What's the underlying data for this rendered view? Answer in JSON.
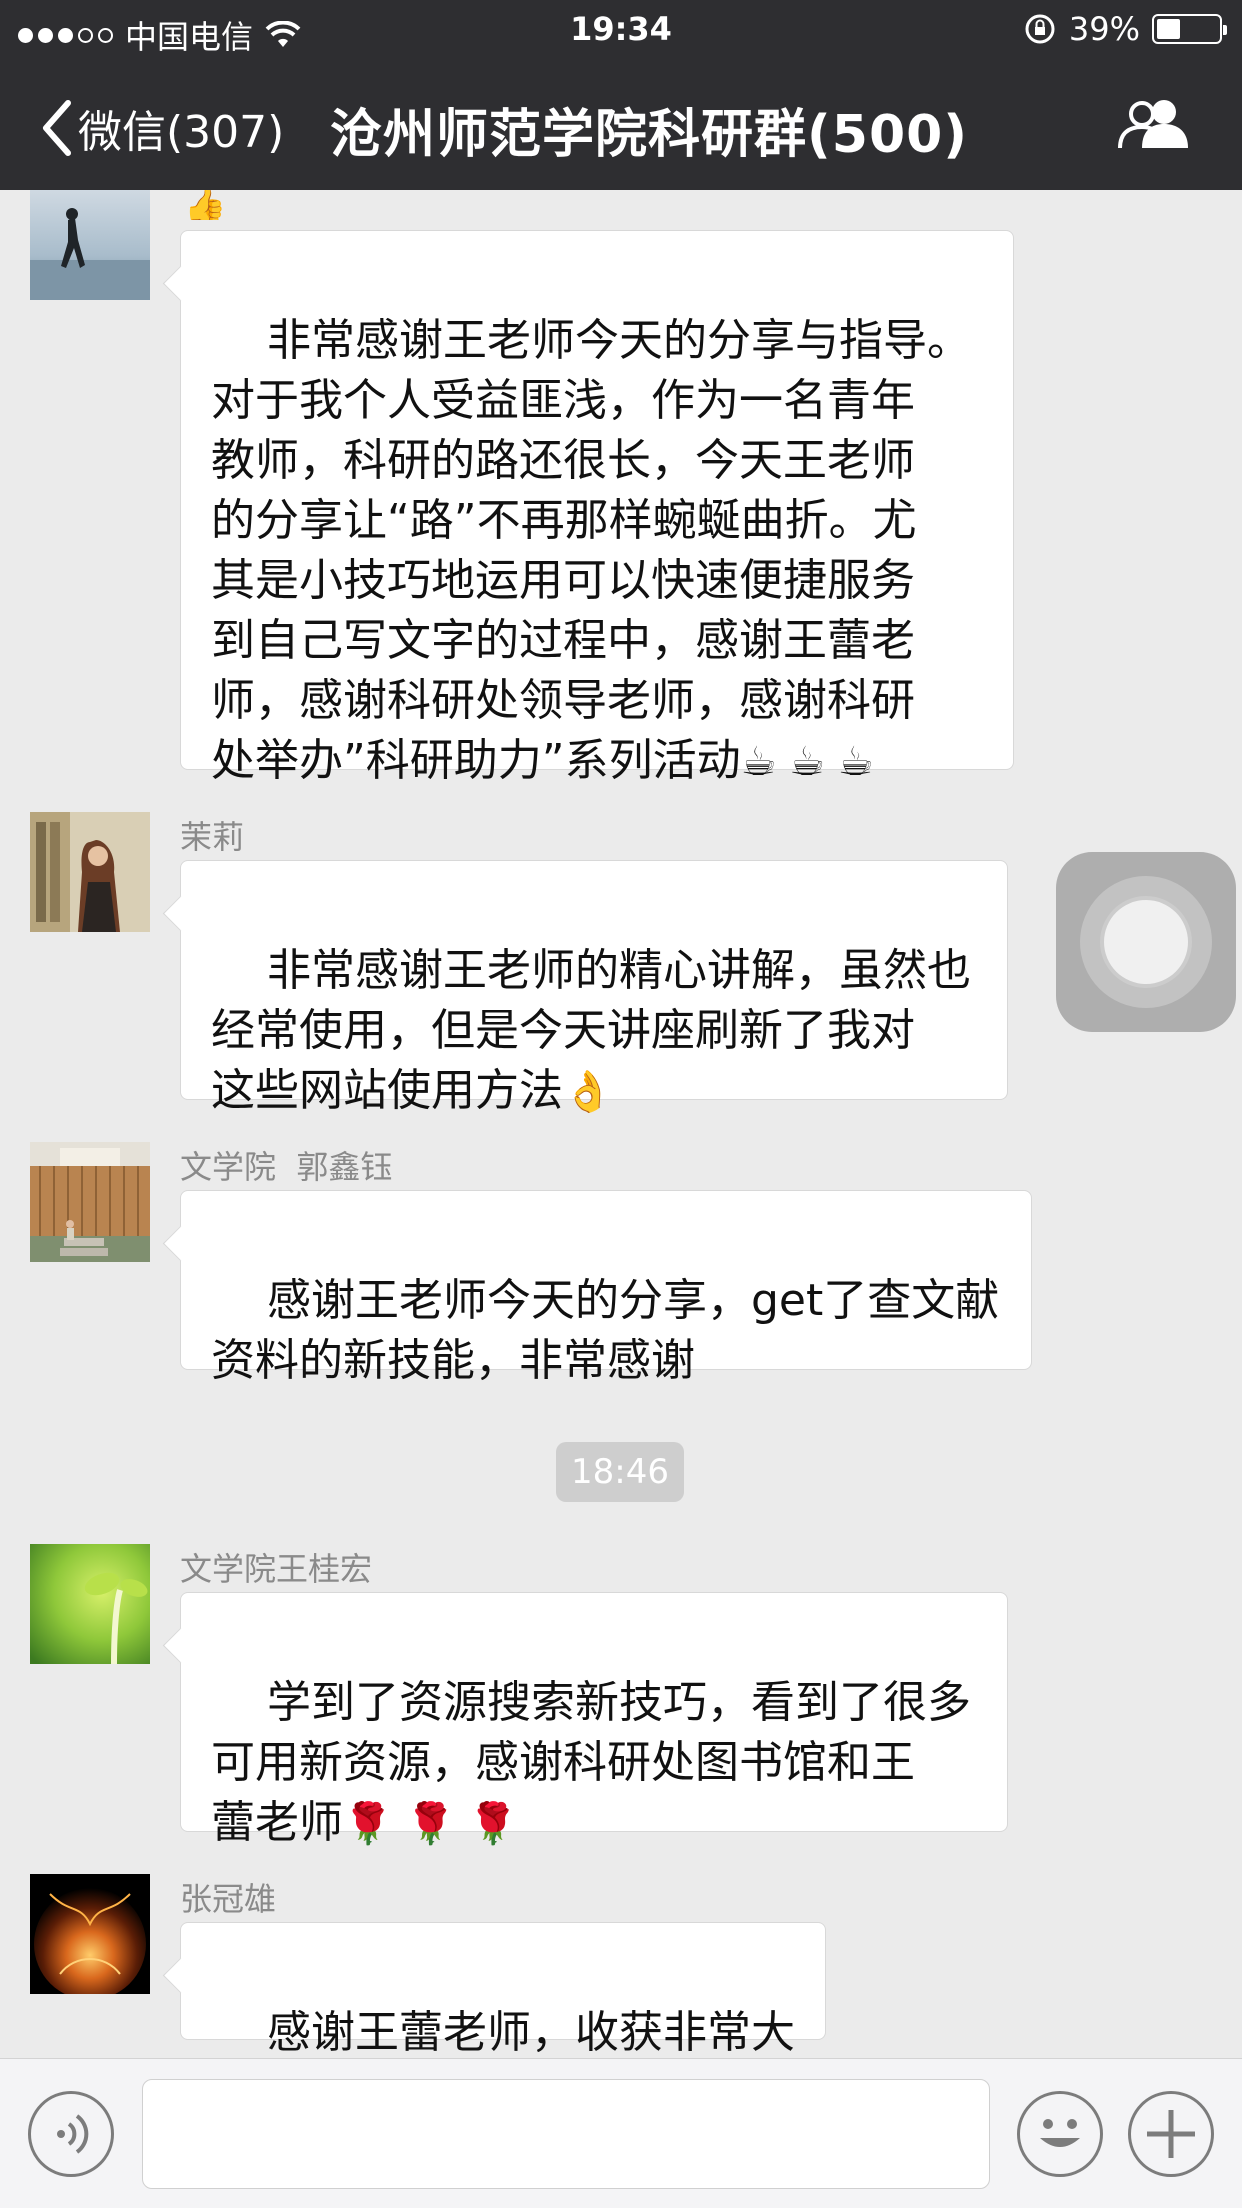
{
  "status_bar": {
    "carrier": "中国电信",
    "time": "19:34",
    "battery": "39%",
    "battery_level": 0.39
  },
  "nav": {
    "back_label": "微信(307)",
    "title": "沧州师范学院科研群(500)"
  },
  "messages": [
    {
      "sender": "",
      "text": "非常感谢王老师今天的分享与指导。\n对于我个人受益匪浅，作为一名青年\n教师，科研的路还很长，今天王老师\n的分享让“路”不再那样蜿蜒曲折。尤\n其是小技巧地运用可以快速便捷服务\n到自己写文字的过程中，感谢王蕾老\n师，感谢科研处领导老师，感谢科研\n处举办”科研助力”系列活动",
      "emoji": "☕ ☕ ☕"
    },
    {
      "sender": "茉莉",
      "text": "非常感谢王老师的精心讲解，虽然也\n经常使用，但是今天讲座刷新了我对\n这些网站使用方法",
      "emoji": "👌"
    },
    {
      "sender": "文学院  郭鑫钰",
      "text": "感谢王老师今天的分享，get了查文献\n资料的新技能，非常感谢",
      "emoji": ""
    },
    {
      "sender": "文学院王桂宏",
      "text": "学到了资源搜索新技巧，看到了很多\n可用新资源，感谢科研处图书馆和王\n蕾老师",
      "emoji": "🌹 🌹 🌹"
    },
    {
      "sender": "张冠雄",
      "text": "感谢王蕾老师，收获非常大",
      "emoji": ""
    }
  ],
  "timestamp": "18:46",
  "partial_emoji": "👍",
  "input": {
    "voice_icon": "voice-icon",
    "emoji_icon": "smiley-icon",
    "more_icon": "plus-icon"
  },
  "colors": {
    "header_bg": "#2e2e31",
    "chat_bg": "#ebebeb",
    "bubble_bg": "#ffffff"
  }
}
